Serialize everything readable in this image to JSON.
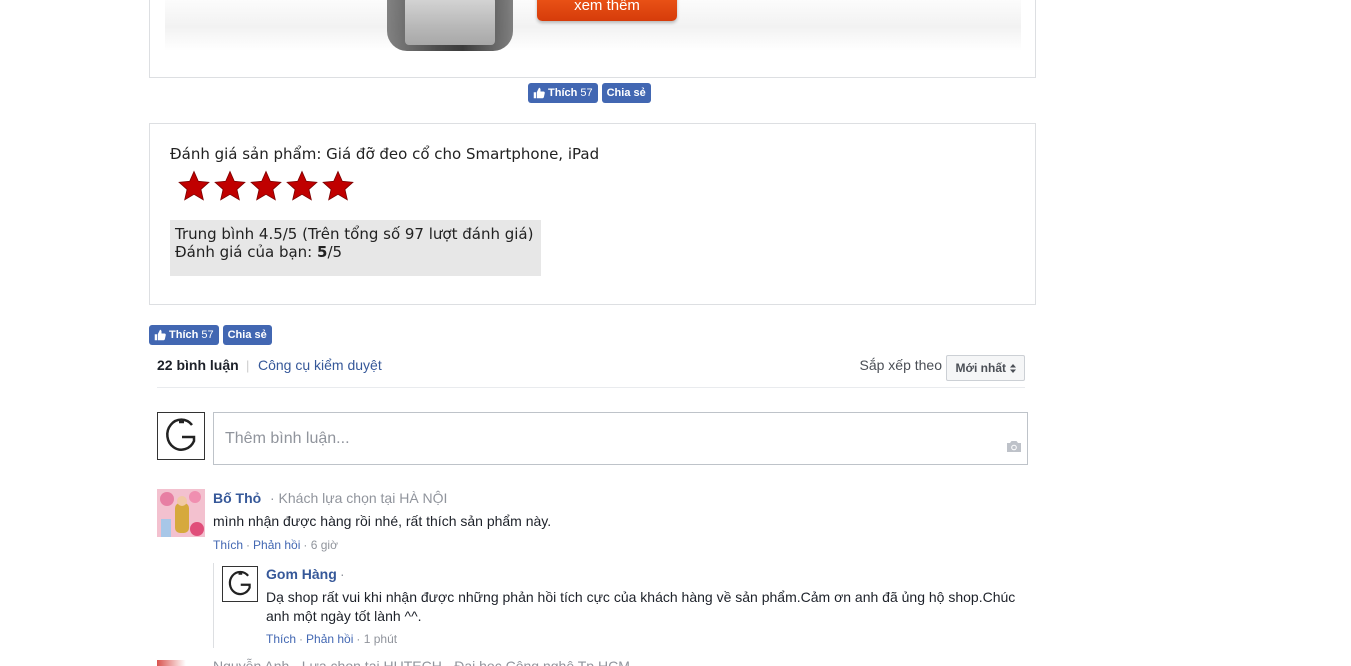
{
  "product_banner": {
    "more_button": "xem thêm"
  },
  "fb_top": {
    "like_label": "Thích",
    "like_count": "57",
    "share_label": "Chia sẻ"
  },
  "rating": {
    "title": "Đánh giá sản phẩm: Giá đỡ đeo cổ cho Smartphone, iPad",
    "stars_filled": 5,
    "stars_total": 5,
    "average_line": "Trung bình 4.5/5 (Trên tổng số 97 lượt đánh giá)",
    "your_rating_prefix": "Đánh giá của bạn: ",
    "your_rating_value": "5",
    "your_rating_suffix": "/5",
    "star_color": "#c00000"
  },
  "fb_bottom": {
    "like_label": "Thích",
    "like_count": "57",
    "share_label": "Chia sẻ"
  },
  "comments": {
    "count_label": "22 bình luận",
    "moderation_link": "Công cụ kiểm duyệt",
    "sort_label": "Sắp xếp theo",
    "sort_value": "Mới nhất",
    "input_placeholder": "Thêm bình luận...",
    "items": [
      {
        "author": "Bố Thỏ",
        "meta": "· Khách lựa chọn tại HÀ NỘI",
        "text": "mình nhận được hàng rồi nhé, rất thích sản phẩm này.",
        "like": "Thích",
        "reply": "Phản hồi",
        "time": "· 6 giờ",
        "replies": [
          {
            "author": "Gom Hàng",
            "meta": "·",
            "text": "Dạ shop rất vui khi nhận được những phản hồi tích cực của khách hàng về sản phẩm.Cảm ơn anh đã ủng hộ shop.Chúc anh một ngày tốt lành ^^.",
            "like": "Thích",
            "reply": "Phản hồi",
            "time": "· 1 phút"
          }
        ]
      }
    ],
    "next_partial": "Nguyễn Anh · Lựa chọn tại HUTECH - Đại học Công nghệ Tp.HCM"
  },
  "colors": {
    "fb_blue": "#4267b2",
    "link_blue": "#365899",
    "orange_button": "#e8501a"
  },
  "icons": [
    "thumbs-up-icon",
    "star-icon",
    "camera-icon",
    "g-logo-icon",
    "sort-arrows-icon"
  ]
}
